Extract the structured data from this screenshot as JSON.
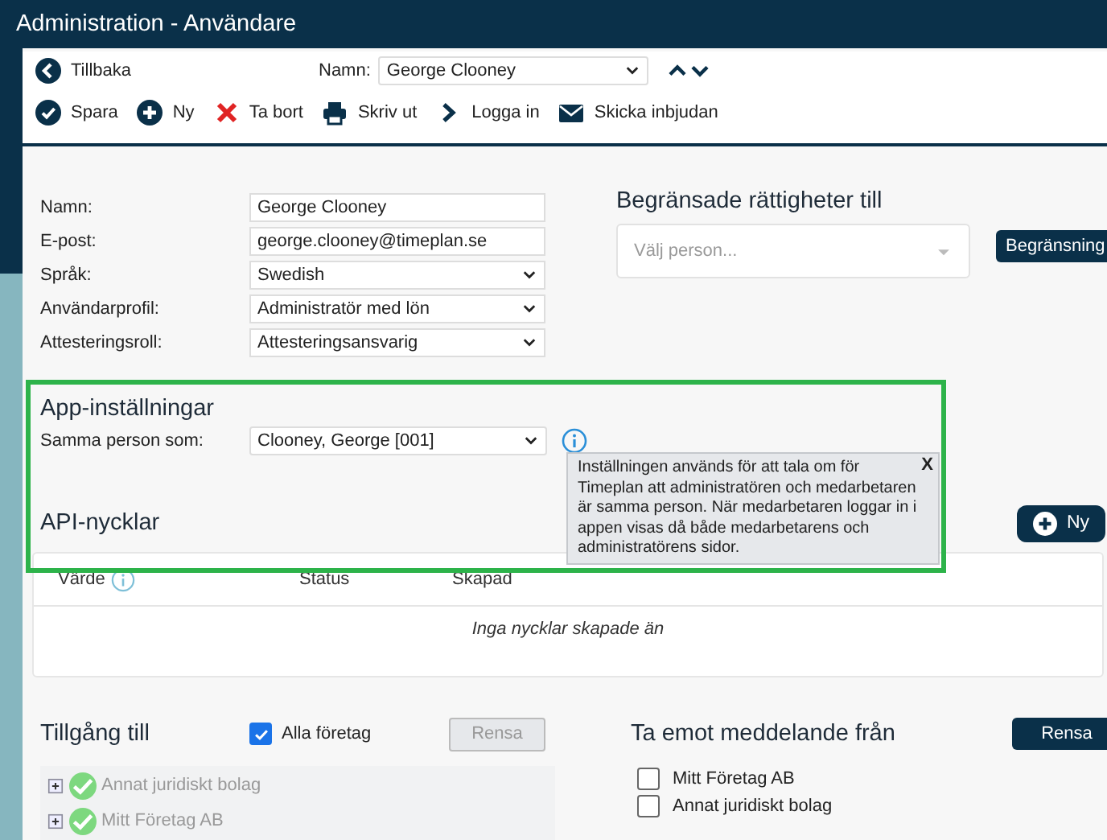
{
  "window": {
    "title": "Administration - Användare"
  },
  "nav": {
    "back": "Tillbaka",
    "name_label": "Namn:",
    "name_value": "George Clooney"
  },
  "toolbar": [
    {
      "kind": "save",
      "label": "Spara"
    },
    {
      "kind": "new",
      "label": "Ny"
    },
    {
      "kind": "delete",
      "label": "Ta bort"
    },
    {
      "kind": "print",
      "label": "Skriv ut"
    },
    {
      "kind": "login",
      "label": "Logga in"
    },
    {
      "kind": "invite",
      "label": "Skicka inbjudan"
    }
  ],
  "user_form": [
    {
      "kind": "text",
      "label": "Namn:",
      "value": "George Clooney"
    },
    {
      "kind": "text",
      "label": "E-post:",
      "value": "george.clooney@timeplan.se"
    },
    {
      "kind": "select",
      "label": "Språk:",
      "value": "Swedish"
    },
    {
      "kind": "select",
      "label": "Användarprofil:",
      "value": "Administratör med lön"
    },
    {
      "kind": "select",
      "label": "Attesteringsroll:",
      "value": "Attesteringsansvarig"
    }
  ],
  "restricted": {
    "title": "Begränsade rättigheter till",
    "placeholder": "Välj person...",
    "button": "Begränsning"
  },
  "app_settings": {
    "title": "App-inställningar",
    "label": "Samma person som:",
    "value": "Clooney, George [001]",
    "tooltip": {
      "text": "Inställningen används för att tala om för Timeplan att administratören och medarbetaren är samma person. När medarbetaren loggar in i appen visas då både medarbetarens och administratörens sidor.",
      "close": "X"
    }
  },
  "api_keys": {
    "title": "API-nycklar",
    "new_button": "Ny",
    "columns": [
      "Värde",
      "Status",
      "Skapad"
    ],
    "empty": "Inga nycklar skapade än"
  },
  "access": {
    "title": "Tillgång till",
    "all_label": "Alla företag",
    "all_checked": true,
    "clear_button": "Rensa",
    "clear_disabled": true,
    "companies": [
      {
        "name": "Annat juridiskt bolag",
        "checked": true
      },
      {
        "name": "Mitt Företag AB",
        "checked": true
      }
    ]
  },
  "messages": {
    "title": "Ta emot meddelande från",
    "clear_button": "Rensa",
    "companies": [
      {
        "name": "Mitt Företag AB",
        "checked": false
      },
      {
        "name": "Annat juridiskt bolag",
        "checked": false
      }
    ]
  }
}
